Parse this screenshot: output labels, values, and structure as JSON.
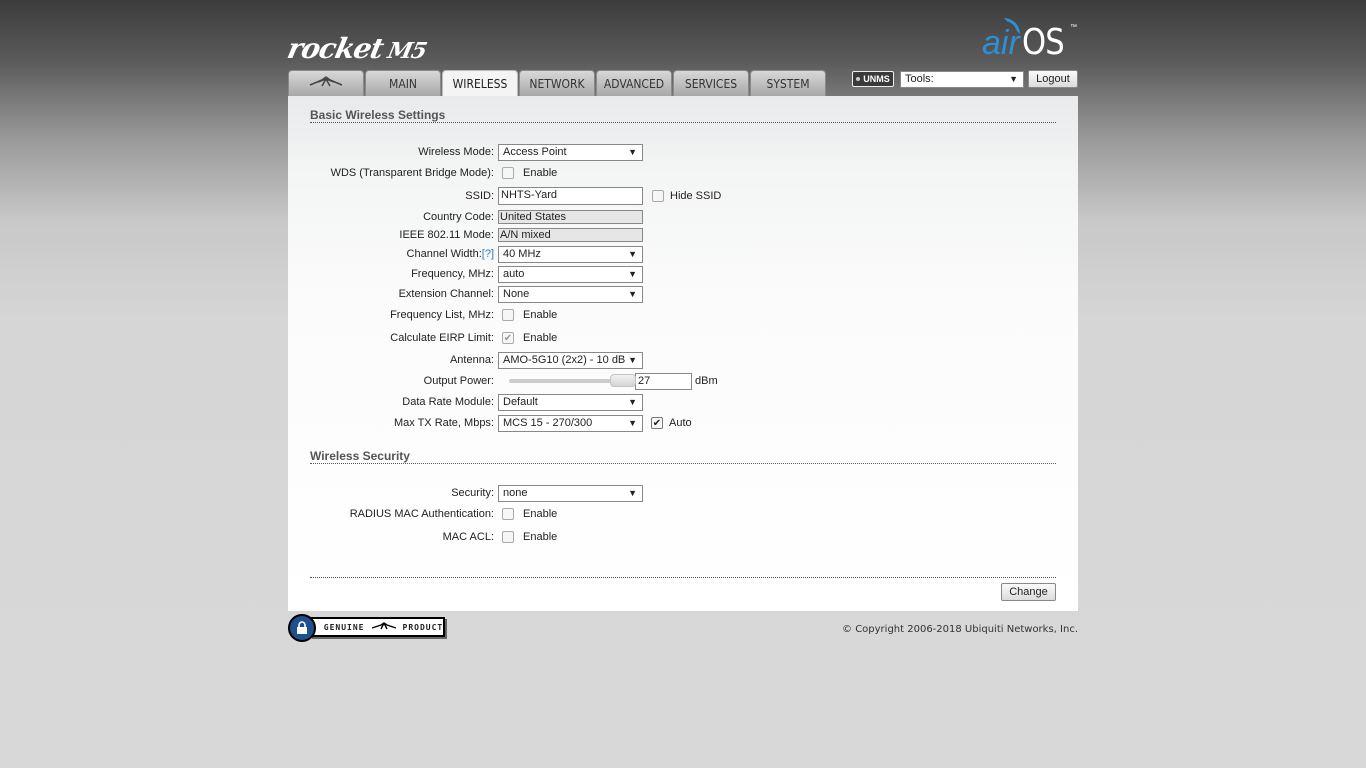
{
  "header": {
    "device_logo": "rocket",
    "device_model": "M5",
    "brand_logo_air": "air",
    "brand_logo_os": "OS",
    "brand_logo_tm": "™"
  },
  "tabs": [
    {
      "label": "",
      "icon": "ubiquiti-logo-icon"
    },
    {
      "label": "MAIN"
    },
    {
      "label": "WIRELESS",
      "active": true
    },
    {
      "label": "NETWORK"
    },
    {
      "label": "ADVANCED"
    },
    {
      "label": "SERVICES"
    },
    {
      "label": "SYSTEM"
    }
  ],
  "toolbar": {
    "unms_label": "UNMS",
    "tools_value": "Tools:",
    "logout_label": "Logout"
  },
  "basic": {
    "title": "Basic Wireless Settings",
    "wireless_mode": {
      "label": "Wireless Mode:",
      "value": "Access Point"
    },
    "wds": {
      "label": "WDS (Transparent Bridge Mode):",
      "option": "Enable",
      "checked": false
    },
    "ssid": {
      "label": "SSID:",
      "value": "NHTS-Yard",
      "hide_label": "Hide SSID",
      "hide_checked": false
    },
    "country_code": {
      "label": "Country Code:",
      "value": "United States"
    },
    "ieee_mode": {
      "label": "IEEE 802.11 Mode:",
      "value": "A/N mixed"
    },
    "channel_width": {
      "label": "Channel Width:",
      "help": "[?]",
      "value": "40 MHz"
    },
    "frequency": {
      "label": "Frequency, MHz:",
      "value": "auto"
    },
    "extension_channel": {
      "label": "Extension Channel:",
      "value": "None"
    },
    "frequency_list": {
      "label": "Frequency List, MHz:",
      "option": "Enable",
      "checked": false
    },
    "eirp": {
      "label": "Calculate EIRP Limit:",
      "option": "Enable",
      "checked": true
    },
    "antenna": {
      "label": "Antenna:",
      "value": "AMO-5G10 (2x2) - 10 dB"
    },
    "output_power": {
      "label": "Output Power:",
      "value": "27",
      "unit": "dBm",
      "slider_level": 0.95
    },
    "data_rate_module": {
      "label": "Data Rate Module:",
      "value": "Default"
    },
    "max_tx_rate": {
      "label": "Max TX Rate, Mbps:",
      "value": "MCS 15 - 270/300",
      "auto_label": "Auto",
      "auto_checked": true
    }
  },
  "security": {
    "title": "Wireless Security",
    "security": {
      "label": "Security:",
      "value": "none"
    },
    "radius_mac": {
      "label": "RADIUS MAC Authentication:",
      "option": "Enable",
      "checked": false
    },
    "mac_acl": {
      "label": "MAC ACL:",
      "option": "Enable",
      "checked": false
    }
  },
  "change_label": "Change",
  "footer": {
    "genuine_text": "GENUINE",
    "product_text": "PRODUCT",
    "copyright": "© Copyright 2006-2018 Ubiquiti Networks, Inc."
  },
  "colors": {
    "accent": "#2d8fd4",
    "help_link": "#2a7fc0"
  }
}
